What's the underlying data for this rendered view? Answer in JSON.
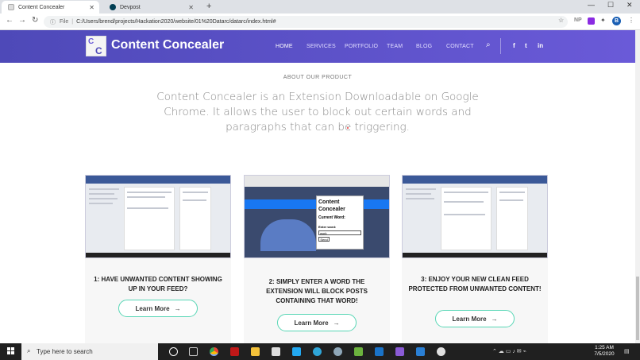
{
  "browser": {
    "tabs": [
      {
        "title": "Content Concealer",
        "active": true
      },
      {
        "title": "Devpost",
        "active": false
      }
    ],
    "address": "C:/Users/brend/projects/Hackation2020/website/01%20Datarc/datarc/index.html#",
    "address_prefix": "File",
    "extension_label": "NP",
    "profile_initial": "B"
  },
  "site": {
    "brand": "Content Concealer",
    "logo_letters": [
      "C",
      "C"
    ],
    "menu": [
      "HOME",
      "SERVICES",
      "PORTFOLIO",
      "TEAM",
      "BLOG",
      "CONTACT"
    ],
    "social": [
      "f",
      "t",
      "in"
    ],
    "accent_color": "#58d6b5",
    "nav_color": "#5a50c8"
  },
  "about": {
    "eyebrow": "ABOUT OUR PRODUCT",
    "lead": "Content Concealer is an Extension Downloadable on Google Chrome. It allows the user to block out certain words and paragraphs that can be triggering."
  },
  "cards": [
    {
      "title": "1: HAVE UNWANTED CONTENT SHOWING UP IN YOUR FEED?",
      "button": "Learn More"
    },
    {
      "title": "2: SIMPLY ENTER A WORD THE EXTENSION WILL BLOCK POSTS CONTAINING THAT WORD!",
      "button": "Learn More"
    },
    {
      "title": "3: ENJOY YOUR NEW CLEAN FEED PROTECTED FROM UNWANTED CONTENT!",
      "button": "Learn More"
    }
  ],
  "popup": {
    "title": "Content Concealer",
    "current_word_label": "Current Word:",
    "enter_word_label": "Enter word:",
    "input_value": "work",
    "send_label": "Send"
  },
  "taskbar": {
    "search_placeholder": "Type here to search",
    "time": "1:25 AM",
    "date": "7/5/2020"
  }
}
